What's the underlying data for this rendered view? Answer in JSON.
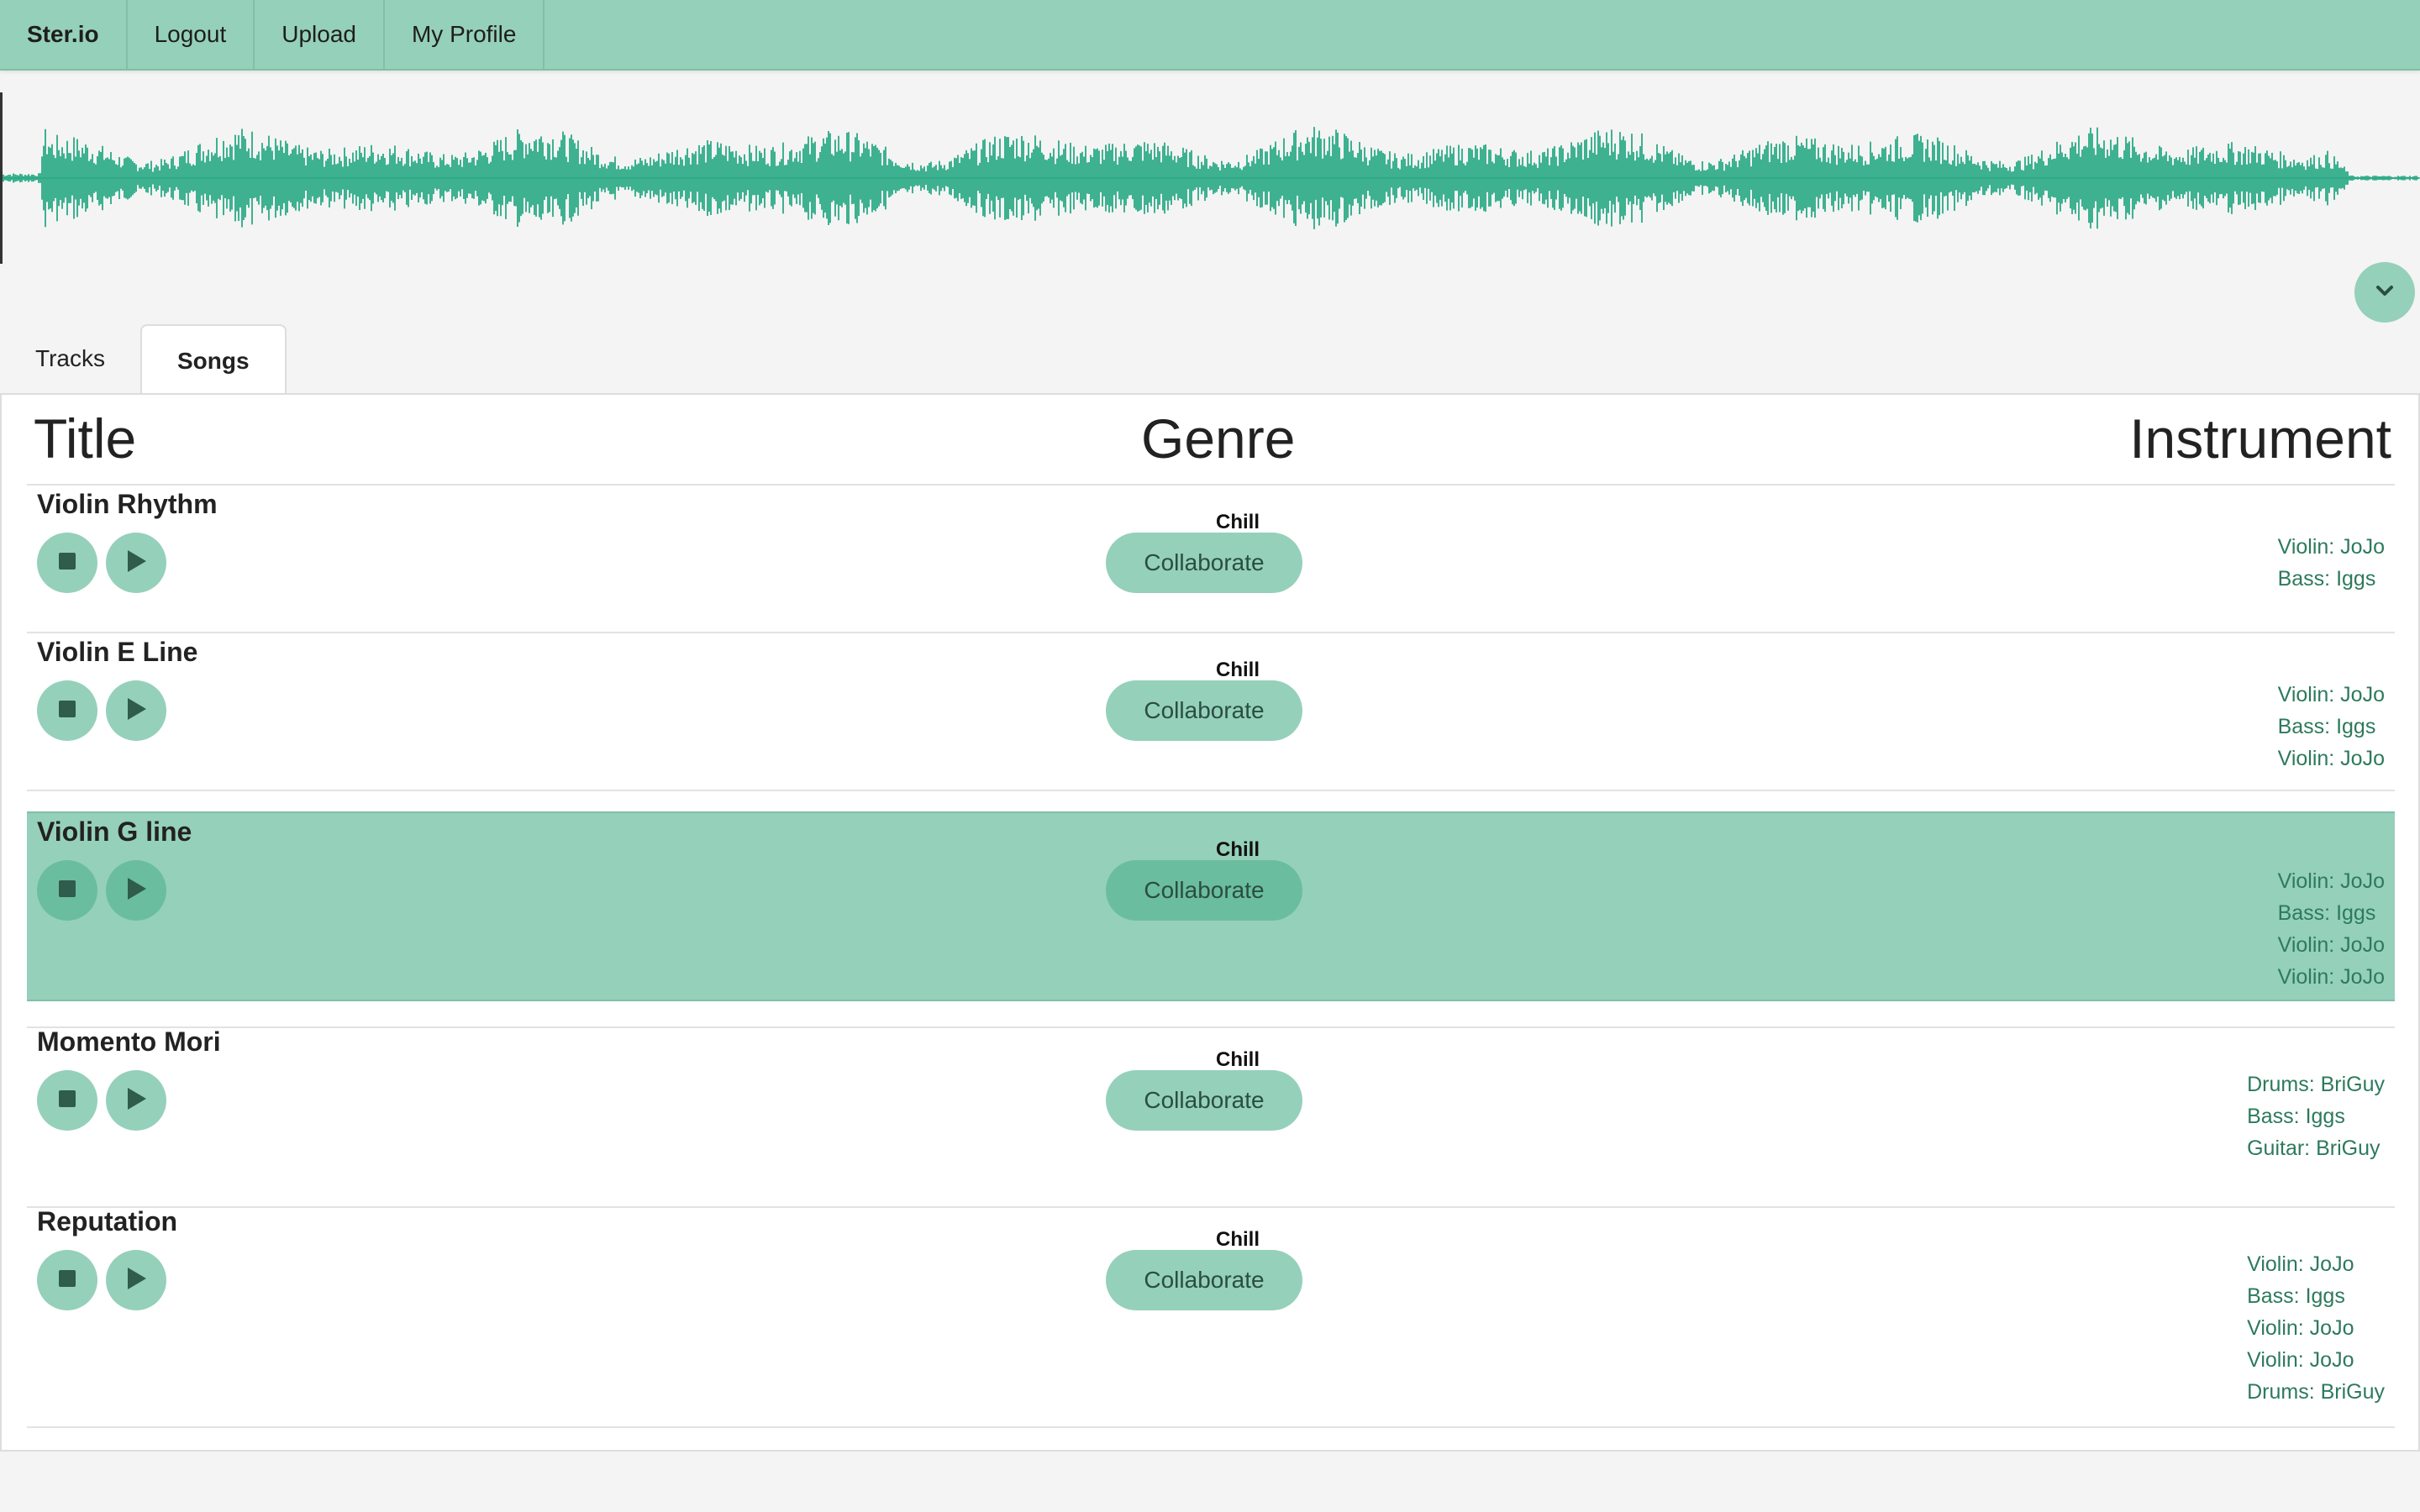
{
  "nav": {
    "brand": "Ster.io",
    "logout": "Logout",
    "upload": "Upload",
    "profile": "My Profile"
  },
  "tabs": {
    "tracks": "Tracks",
    "songs": "Songs"
  },
  "headers": {
    "title": "Title",
    "genre": "Genre",
    "instrument": "Instrument"
  },
  "collab_label": "Collaborate",
  "colors": {
    "accent": "#95d0bb",
    "accent_dark": "#6bbd9f",
    "wave": "#1fa67f",
    "link": "#2d7a5c"
  },
  "icons": {
    "stop": "stop-icon",
    "play": "play-icon",
    "collapse": "chevron-down-icon"
  },
  "songs": [
    {
      "title": "Violin Rhythm",
      "genre": "Chill",
      "instruments": [
        "Violin: JoJo",
        "Bass: Iggs"
      ]
    },
    {
      "title": "Violin E Line",
      "genre": "Chill",
      "instruments": [
        "Violin: JoJo",
        "Bass: Iggs",
        "Violin: JoJo"
      ]
    },
    {
      "title": "Violin G line",
      "genre": "Chill",
      "active": true,
      "instruments": [
        "Violin: JoJo",
        "Bass: Iggs",
        "Violin: JoJo",
        "Violin: JoJo"
      ]
    },
    {
      "title": "Momento Mori",
      "genre": "Chill",
      "instruments": [
        "Drums: BriGuy",
        "Bass: Iggs",
        "Guitar: BriGuy"
      ]
    },
    {
      "title": "Reputation",
      "genre": "Chill",
      "instruments": [
        "Violin: JoJo",
        "Bass: Iggs",
        "Violin: JoJo",
        "Violin: JoJo",
        "Drums: BriGuy"
      ]
    }
  ]
}
